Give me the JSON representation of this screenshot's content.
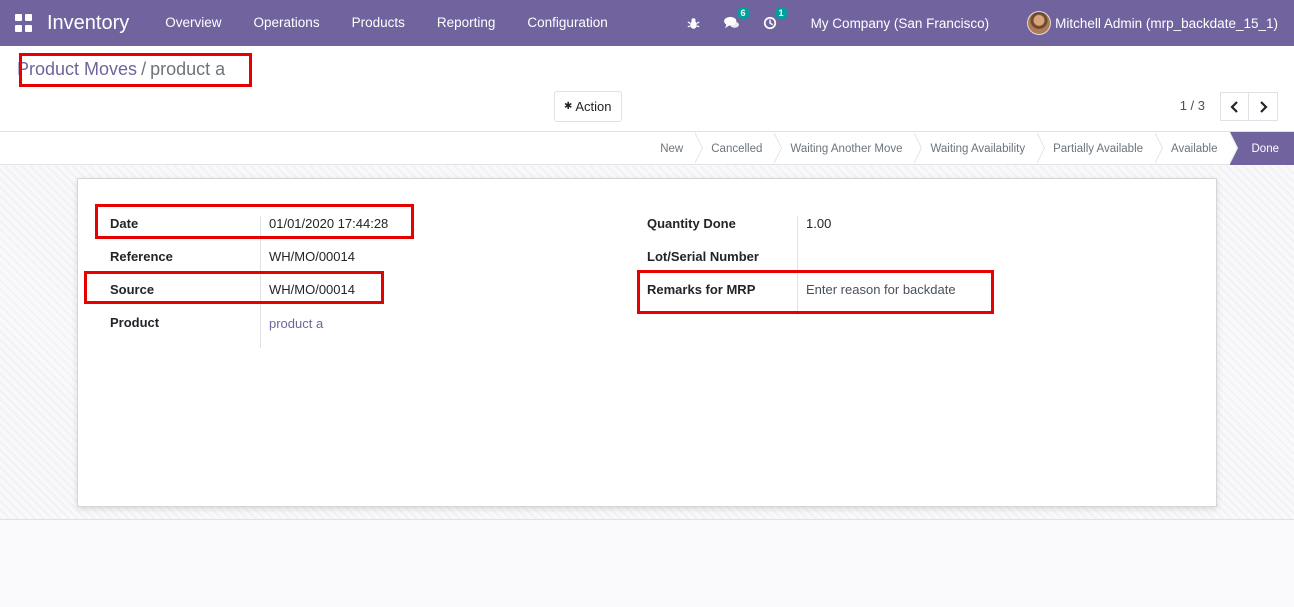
{
  "navbar": {
    "app_title": "Inventory",
    "menu": [
      "Overview",
      "Operations",
      "Products",
      "Reporting",
      "Configuration"
    ],
    "messages_badge": "6",
    "activity_badge": "1",
    "company": "My Company (San Francisco)",
    "user": "Mitchell Admin (mrp_backdate_15_1)"
  },
  "breadcrumb": {
    "parent": "Product Moves",
    "separator": "/",
    "current": "product a"
  },
  "toolbar": {
    "action_label": "Action",
    "pager": "1 / 3"
  },
  "statusbar": {
    "stages": [
      "New",
      "Cancelled",
      "Waiting Another Move",
      "Waiting Availability",
      "Partially Available",
      "Available",
      "Done"
    ],
    "active": "Done"
  },
  "form": {
    "left": [
      {
        "label": "Date",
        "value": "01/01/2020 17:44:28"
      },
      {
        "label": "Reference",
        "value": "WH/MO/00014"
      },
      {
        "label": "Source",
        "value": "WH/MO/00014"
      },
      {
        "label": "Product",
        "value": "product a"
      }
    ],
    "right": [
      {
        "label": "Quantity Done",
        "value": "1.00"
      },
      {
        "label": "Lot/Serial Number",
        "value": ""
      },
      {
        "label": "Remarks for MRP",
        "value": "Enter reason for backdate"
      }
    ]
  },
  "colors": {
    "brand": "#71639e",
    "highlight": "#e60000",
    "badge": "#00a09d"
  }
}
